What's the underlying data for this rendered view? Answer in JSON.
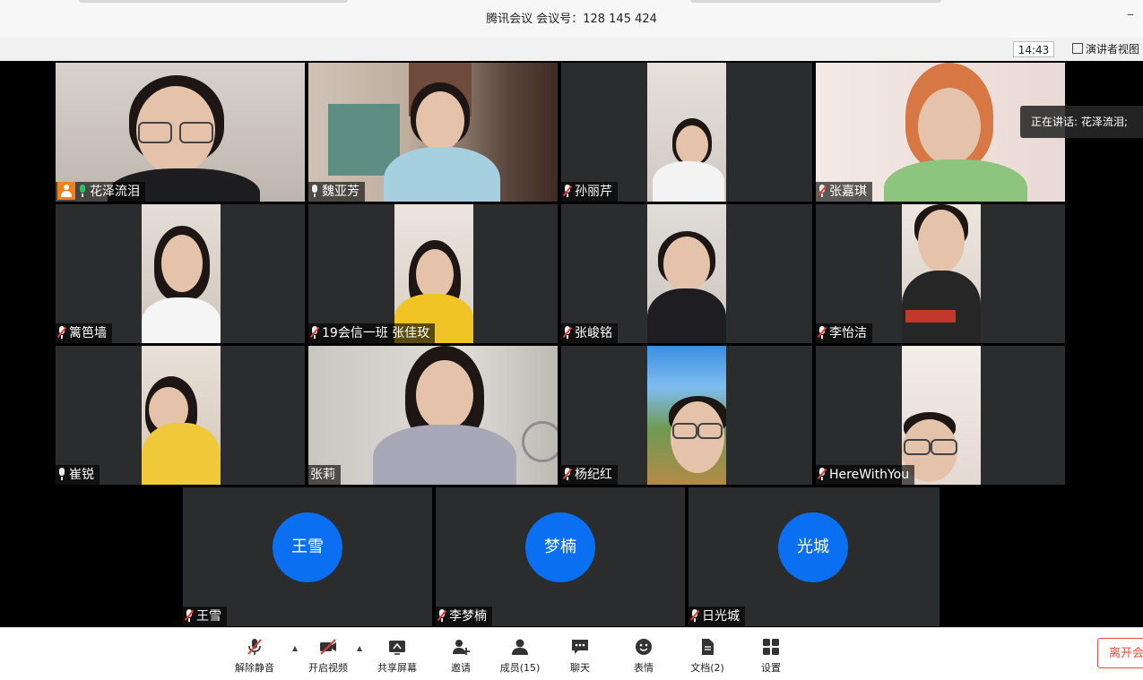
{
  "window": {
    "title": "腾讯会议 会议号：128 145 424",
    "minimize_glyph": "–"
  },
  "subbar": {
    "clock": "14:43",
    "view_button": "演讲者视图"
  },
  "speaking_indicator": "正在讲话: 花泽流泪;",
  "participants": [
    {
      "name": "花泽流泪",
      "mic": "live",
      "host": true
    },
    {
      "name": "魏亚芳",
      "mic": "on"
    },
    {
      "name": "孙丽芹",
      "mic": "muted"
    },
    {
      "name": "张嘉琪",
      "mic": "muted"
    },
    {
      "name": "篱笆墙",
      "mic": "muted"
    },
    {
      "name": "19会信一班 张佳玫",
      "mic": "muted"
    },
    {
      "name": "张峻铭",
      "mic": "muted"
    },
    {
      "name": "李怡洁",
      "mic": "muted"
    },
    {
      "name": "崔锐",
      "mic": "on"
    },
    {
      "name": "张莉",
      "mic": "none"
    },
    {
      "name": "杨纪红",
      "mic": "muted"
    },
    {
      "name": "HereWithYou",
      "mic": "muted"
    },
    {
      "name": "王雪",
      "mic": "muted",
      "avatar_text": "王雪"
    },
    {
      "name": "李梦楠",
      "mic": "muted",
      "avatar_text": "梦楠"
    },
    {
      "name": "日光城",
      "mic": "muted",
      "avatar_text": "光城"
    }
  ],
  "toolbar": {
    "unmute": "解除静音",
    "start_video": "开启视频",
    "share_screen": "共享屏幕",
    "invite": "邀请",
    "members": "成员(15)",
    "chat": "聊天",
    "reactions": "表情",
    "documents": "文档(2)",
    "settings": "设置",
    "leave": "离开会"
  },
  "colors": {
    "avatar_blue": "#0a6ff0",
    "active_speaker_border": "#1bbf6b",
    "muted_red": "#e53b3b",
    "leave_red": "#e74c3c",
    "tile_bg": "#2b2c2e"
  }
}
